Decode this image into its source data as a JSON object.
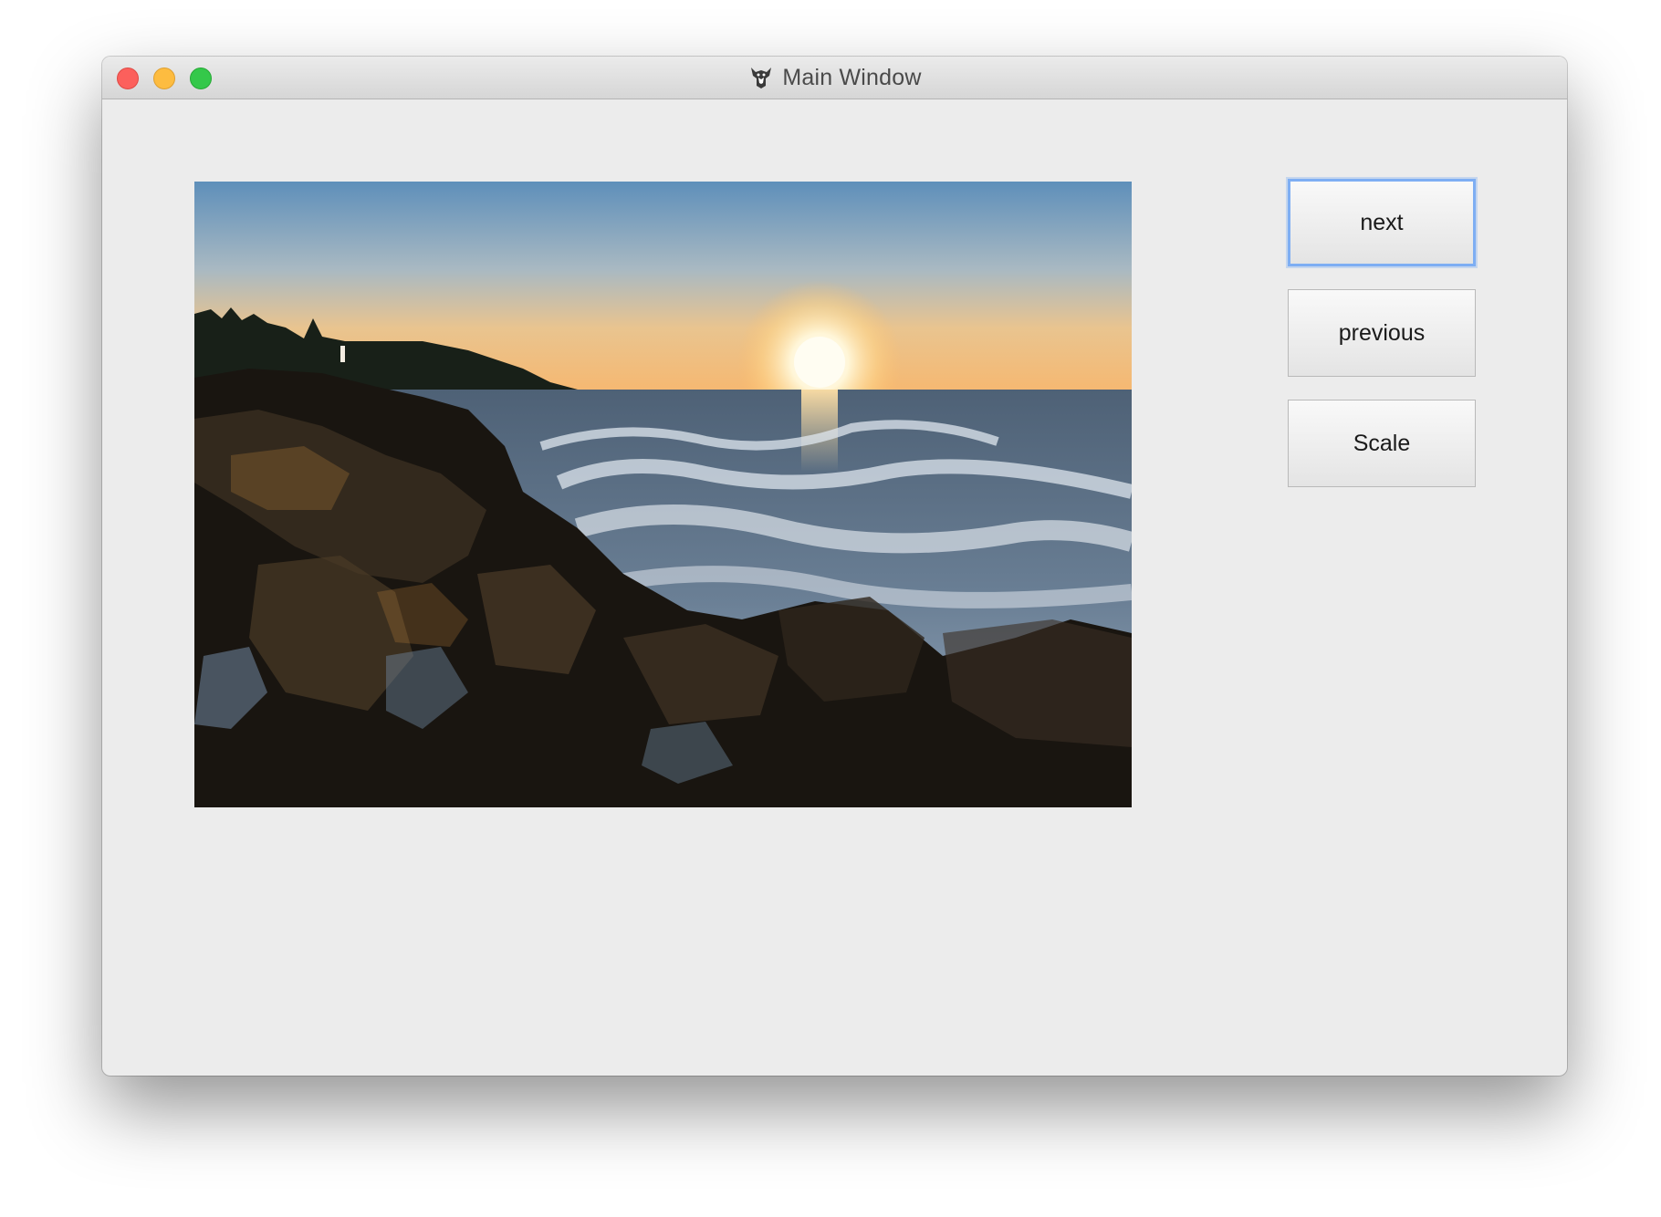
{
  "window": {
    "title": "Main Window",
    "title_icon": "fox-icon"
  },
  "main": {
    "image": {
      "description_icon": "photo-coastal-sunset"
    },
    "buttons": {
      "next_label": "next",
      "previous_label": "previous",
      "scale_label": "Scale"
    }
  },
  "colors": {
    "close": "#fc605c",
    "minimize": "#fdbc40",
    "zoom": "#34c84a",
    "focus_ring": "#7eaef3",
    "window_bg": "#ececec"
  }
}
